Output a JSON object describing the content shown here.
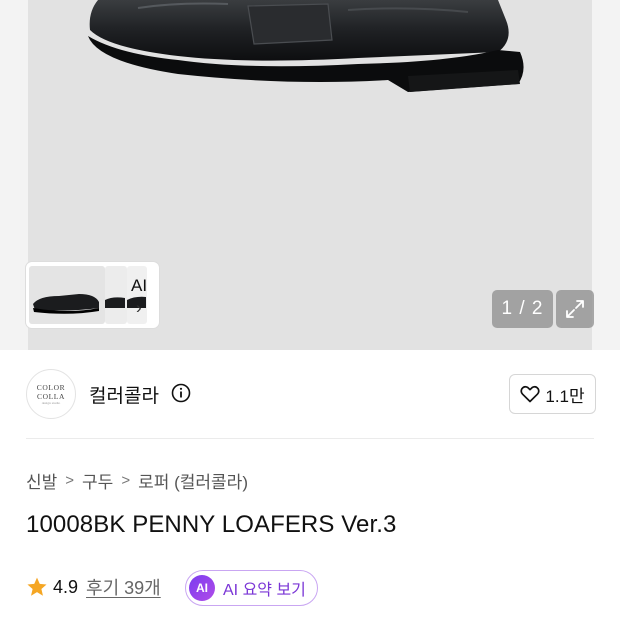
{
  "gallery": {
    "counter": "1 / 2",
    "ai_label": "AI",
    "ai_chevron": "›",
    "expand_icon": "expand-arrows-icon",
    "background": "#e2e2e2"
  },
  "brand": {
    "logo_line1": "COLOR",
    "logo_line2": "COLLA",
    "logo_line3": "design studio",
    "name": "컬러콜라",
    "info_icon": "info-circle-icon",
    "like_icon": "heart-outline-icon",
    "like_count": "1.1만"
  },
  "breadcrumb": {
    "items": [
      "신발",
      "구두",
      "로퍼 (컬러콜라)"
    ],
    "separator": ">"
  },
  "product": {
    "title": "10008BK PENNY LOAFERS Ver.3"
  },
  "rating": {
    "star_icon": "star-filled-icon",
    "score": "4.9",
    "reviews": "후기 39개",
    "star_color": "#f5a623"
  },
  "ai_summary": {
    "badge": "AI",
    "label": "AI 요약 보기",
    "accent": "#7a35d6"
  }
}
